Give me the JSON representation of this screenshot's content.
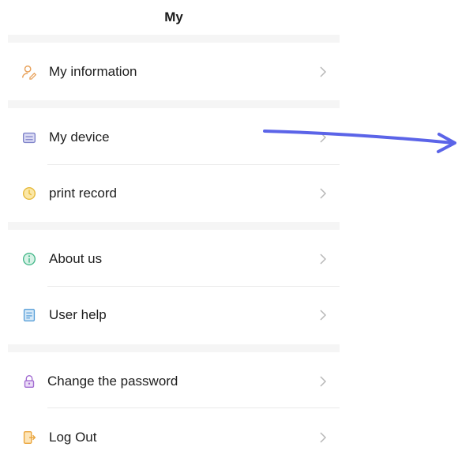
{
  "header": {
    "title": "My"
  },
  "menu": {
    "items": [
      {
        "label": "My information",
        "icon": "user-edit-icon"
      },
      {
        "label": "My device",
        "icon": "printer-icon"
      },
      {
        "label": "print record",
        "icon": "clock-icon"
      },
      {
        "label": "About us",
        "icon": "info-icon"
      },
      {
        "label": "User help",
        "icon": "help-document-icon"
      },
      {
        "label": "Change the password",
        "icon": "lock-icon"
      },
      {
        "label": "Log Out",
        "icon": "logout-icon"
      }
    ]
  },
  "annotation": {
    "icon": "pointer-arrow-icon",
    "color": "#5b64e8"
  },
  "colors": {
    "section_gap": "#f5f5f5",
    "chevron": "#b8b8b8",
    "divider": "#e9e9e9"
  }
}
